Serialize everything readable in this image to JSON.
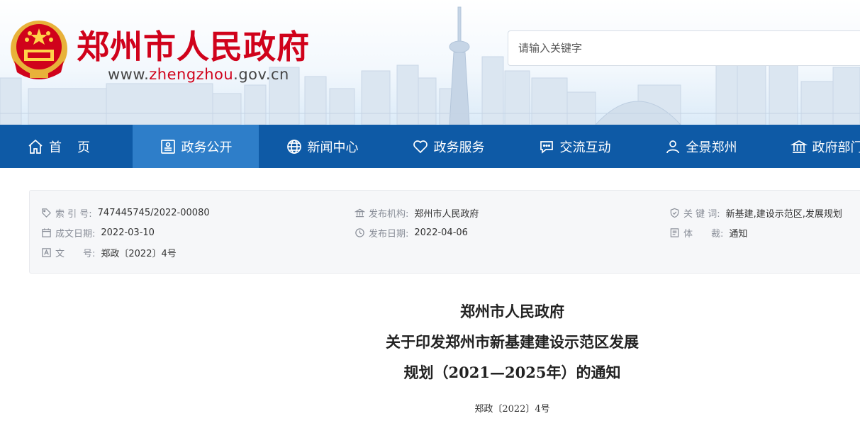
{
  "header": {
    "site_title": "郑州市人民政府",
    "url_prefix": "www.",
    "url_highlight": "zhengzhou",
    "url_suffix": ".gov.cn",
    "search_placeholder": "请输入关键字"
  },
  "nav": {
    "items": [
      {
        "label": "首页",
        "icon": "home-icon"
      },
      {
        "label": "政务公开",
        "icon": "document-icon",
        "active": true
      },
      {
        "label": "新闻中心",
        "icon": "globe-icon"
      },
      {
        "label": "政务服务",
        "icon": "heart-icon"
      },
      {
        "label": "交流互动",
        "icon": "chat-icon"
      },
      {
        "label": "全景郑州",
        "icon": "user-icon"
      },
      {
        "label": "政府部门",
        "icon": "building-icon"
      }
    ]
  },
  "info": {
    "index_label": "索 引 号:",
    "index_value": "747445745/2022-00080",
    "publisher_label": "发布机构:",
    "publisher_value": "郑州市人民政府",
    "keywords_label": "关 键 词:",
    "keywords_value": "新基建,建设示范区,发展规划",
    "created_label": "成文日期:",
    "created_value": "2022-03-10",
    "published_label": "发布日期:",
    "published_value": "2022-04-06",
    "genre_label": "体　　裁:",
    "genre_value": "通知",
    "docno_label": "文　　号:",
    "docno_value": "郑政〔2022〕4号"
  },
  "document": {
    "title_line1": "郑州市人民政府",
    "title_line2": "关于印发郑州市新基建建设示范区发展",
    "title_line3": "规划（2021—2025年）的通知",
    "number": "郑政〔2022〕4号"
  },
  "colors": {
    "brand_red": "#d0021b",
    "nav_blue": "#0e5aa6",
    "nav_active": "#2e7ec9"
  }
}
